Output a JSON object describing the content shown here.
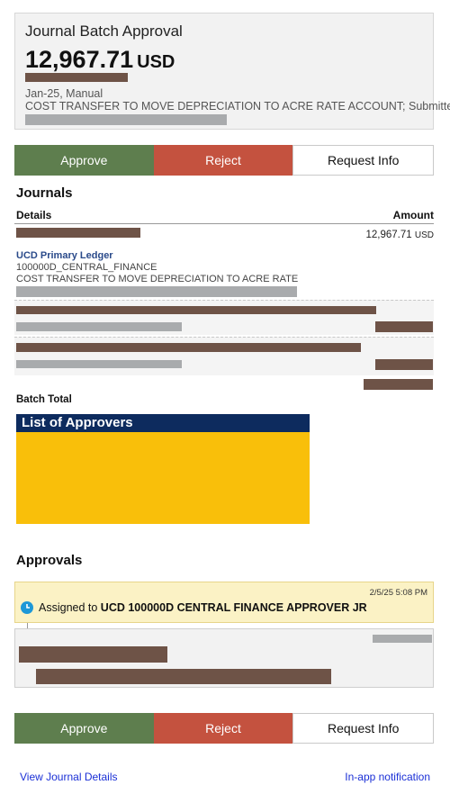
{
  "header": {
    "title": "Journal Batch Approval",
    "amount": "12,967.71",
    "currency": "USD",
    "meta": "Jan-25, Manual",
    "description": "COST TRANSFER TO MOVE DEPRECIATION TO ACRE RATE ACCOUNT; Submitted"
  },
  "actions": {
    "approve": "Approve",
    "reject": "Reject",
    "request_info": "Request Info"
  },
  "journals": {
    "title": "Journals",
    "col_details": "Details",
    "col_amount": "Amount",
    "amount_value": "12,967.71",
    "amount_currency": "USD",
    "ledger": "UCD Primary Ledger",
    "account": "100000D_CENTRAL_FINANCE",
    "line_description": "COST TRANSFER TO MOVE DEPRECIATION TO ACRE RATE"
  },
  "batch_total": {
    "label": "Batch Total"
  },
  "approvers": {
    "title": "List of Approvers"
  },
  "approvals": {
    "title": "Approvals",
    "timestamp": "2/5/25 5:08 PM",
    "assigned_prefix": "Assigned to ",
    "assignee": "UCD 100000D CENTRAL FINANCE APPROVER JR"
  },
  "footer": {
    "view_details": "View Journal Details",
    "notification": "In-app notification"
  },
  "colors": {
    "approve": "#5e7e4e",
    "reject": "#c4523f",
    "approvers_header": "#0d2b5e",
    "approvers_body": "#f9bf0a",
    "link": "#1a2fd6"
  }
}
